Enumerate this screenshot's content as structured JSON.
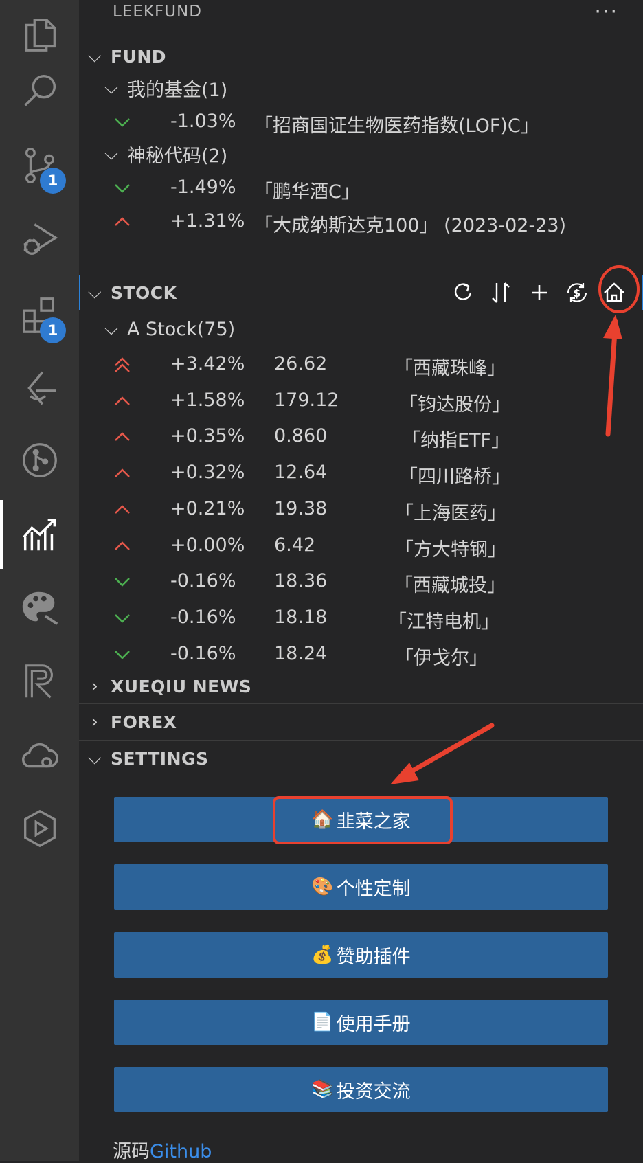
{
  "activity_bar": {
    "items": [
      {
        "icon": "files-icon"
      },
      {
        "icon": "search-icon"
      },
      {
        "icon": "source-control-icon",
        "badge": "1"
      },
      {
        "icon": "run-debug-icon"
      },
      {
        "icon": "extensions-icon",
        "badge": "1"
      },
      {
        "icon": "ai-assistant-icon"
      },
      {
        "icon": "git-graph-icon"
      },
      {
        "icon": "leekfund-chart-icon",
        "active": true
      },
      {
        "icon": "palette-icon"
      },
      {
        "icon": "r-logo-icon"
      },
      {
        "icon": "cloud-icon"
      },
      {
        "icon": "play-hexagon-icon"
      }
    ]
  },
  "panel": {
    "title": "LEEKFUND",
    "more": "···"
  },
  "fund": {
    "header": "FUND",
    "groups": [
      {
        "label": "我的基金(1)",
        "rows": [
          {
            "trend": "down",
            "change": "-1.03%",
            "name": "「招商国证生物医药指数(LOF)C」"
          }
        ]
      },
      {
        "label": "神秘代码(2)",
        "rows": [
          {
            "trend": "down",
            "change": "-1.49%",
            "name": "「鹏华酒C」"
          },
          {
            "trend": "up",
            "change": "+1.31%",
            "name": "「大成纳斯达克100」 (2023-02-23)"
          }
        ]
      }
    ]
  },
  "stock": {
    "header": "STOCK",
    "group_label": "A Stock(75)",
    "rows": [
      {
        "trend": "up-double",
        "change": "+3.42%",
        "price": "26.62",
        "name": "「西藏珠峰」"
      },
      {
        "trend": "up",
        "change": "+1.58%",
        "price": "179.12",
        "name": "「钧达股份」"
      },
      {
        "trend": "up",
        "change": "+0.35%",
        "price": "0.860",
        "name": "「纳指ETF」"
      },
      {
        "trend": "up",
        "change": "+0.32%",
        "price": "12.64",
        "name": "「四川路桥」"
      },
      {
        "trend": "up",
        "change": "+0.21%",
        "price": "19.38",
        "name": "「上海医药」"
      },
      {
        "trend": "up",
        "change": "+0.00%",
        "price": "6.42",
        "name": "「方大特钢」"
      },
      {
        "trend": "down",
        "change": "-0.16%",
        "price": "18.36",
        "name": "「西藏城投」"
      },
      {
        "trend": "down",
        "change": "-0.16%",
        "price": "18.18",
        "name": "「江特电机」"
      },
      {
        "trend": "down",
        "change": "-0.16%",
        "price": "18.24",
        "name": "「伊戈尔」"
      }
    ]
  },
  "xueqiu": {
    "header": "XUEQIU NEWS"
  },
  "forex": {
    "header": "FOREX"
  },
  "settings": {
    "header": "SETTINGS",
    "buttons": [
      {
        "emoji": "🏠",
        "label": "韭菜之家"
      },
      {
        "emoji": "🎨",
        "label": "个性定制"
      },
      {
        "emoji": "💰",
        "label": "赞助插件"
      },
      {
        "emoji": "📄",
        "label": "使用手册"
      },
      {
        "emoji": "📚",
        "label": "投资交流"
      }
    ],
    "source_prefix": "源码",
    "source_link": "Github"
  },
  "colors": {
    "up": "#e4574a",
    "down": "#4caf50",
    "button_bg": "#2c6399",
    "annotation": "#e8412f"
  }
}
